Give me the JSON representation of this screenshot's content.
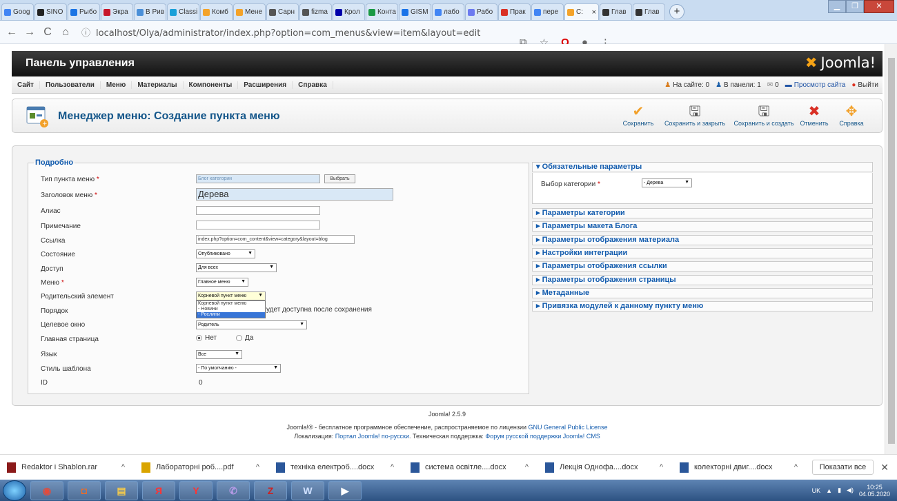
{
  "browser": {
    "tabs": [
      {
        "label": "Goog",
        "color": "#4285f4"
      },
      {
        "label": "SINO",
        "color": "#222"
      },
      {
        "label": "Рыбо",
        "color": "#1b74e4"
      },
      {
        "label": "Экра",
        "color": "#c7172b"
      },
      {
        "label": "В Рив",
        "color": "#4a8fd8"
      },
      {
        "label": "Classi",
        "color": "#1aa0d8"
      },
      {
        "label": "Комб",
        "color": "#f4a32a"
      },
      {
        "label": "Мене",
        "color": "#f4a32a"
      },
      {
        "label": "Сарн",
        "color": "#555"
      },
      {
        "label": "fizma",
        "color": "#555"
      },
      {
        "label": "Крол",
        "color": "#00a"
      },
      {
        "label": "Конта",
        "color": "#1a9944"
      },
      {
        "label": "GISM",
        "color": "#1a73e8"
      },
      {
        "label": "лабо",
        "color": "#4285f4"
      },
      {
        "label": "Рабо",
        "color": "#6b7af0"
      },
      {
        "label": "Прак",
        "color": "#d93025"
      },
      {
        "label": "пере",
        "color": "#4285f4"
      },
      {
        "label": "C:",
        "color": "#f4a32a",
        "active": true
      },
      {
        "label": "Глав",
        "color": "#333"
      },
      {
        "label": "Глав",
        "color": "#333"
      }
    ],
    "url": "localhost/Olya/administrator/index.php?option=com_menus&view=item&layout=edit"
  },
  "header": {
    "title": "Панель управления",
    "logo": "Joomla!"
  },
  "menu": [
    "Сайт",
    "Пользователи",
    "Меню",
    "Материалы",
    "Компоненты",
    "Расширения",
    "Справка"
  ],
  "status": {
    "online": "На сайте: 0",
    "panel": "В панели: 1",
    "messages": "0",
    "view_site": "Просмотр сайта",
    "logout": "Выйти"
  },
  "toolbar": {
    "title": "Менеджер меню: Создание пункта меню",
    "save": "Сохранить",
    "save_close": "Сохранить и закрыть",
    "save_new": "Сохранить и создать",
    "cancel": "Отменить",
    "help": "Справка"
  },
  "form": {
    "legend": "Подробно",
    "type_label": "Тип пункта меню",
    "type_value": "Блог категории",
    "select_btn": "Выбрать",
    "title_label": "Заголовок меню",
    "title_value": "Дерева",
    "alias_label": "Алиас",
    "note_label": "Примечание",
    "link_label": "Ссылка",
    "link_value": "index.php?option=com_content&view=category&layout=blog",
    "state_label": "Состояние",
    "state_value": "Опубликовано",
    "access_label": "Доступ",
    "access_value": "Для всех",
    "menu_label": "Меню",
    "menu_value": "Главное меню",
    "parent_label": "Родительский элемент",
    "parent_value": "Корневой пункт меню",
    "parent_options": [
      "Корневой пункт меню",
      "- Новини",
      "- Рослини"
    ],
    "order_label": "Порядок",
    "order_note": "удет доступна после сохранения",
    "target_label": "Целевое окно",
    "target_value": "Родитель",
    "home_label": "Главная страница",
    "home_no": "Нет",
    "home_yes": "Да",
    "lang_label": "Язык",
    "lang_value": "Все",
    "style_label": "Стиль шаблона",
    "style_value": "- По умолчанию -",
    "id_label": "ID",
    "id_value": "0"
  },
  "panels": {
    "required": "▾ Обязательные параметры",
    "cat_label": "Выбор категории",
    "cat_value": "- Дерева",
    "list": [
      "▸ Параметры категории",
      "▸ Параметры макета Блога",
      "▸ Параметры отображения материала",
      "▸ Настройки интеграции",
      "▸ Параметры отображения ссылки",
      "▸ Параметры отображения страницы",
      "▸ Метаданные",
      "▸ Привязка модулей к данному пункту меню"
    ]
  },
  "footer": {
    "version": "Joomla! 2.5.9",
    "line1a": "Joomla!® - бесплатное программное обеспечение, распространяемое по лицензии ",
    "line1b": "GNU General Public License",
    "line2a": "Локализация: ",
    "line2b": "Портал Joomla! по-русски",
    "line2c": ". Техническая поддержка: ",
    "line2d": "Форум русской поддержки Joomla! CMS"
  },
  "downloads": {
    "items": [
      {
        "name": "Redaktor i Shablon.rar",
        "type": "rar"
      },
      {
        "name": "Лабораторні роб....pdf",
        "type": "pdf"
      },
      {
        "name": "техніка електроб....docx",
        "type": "docx"
      },
      {
        "name": "система освітле....docx",
        "type": "docx"
      },
      {
        "name": "Лекція Однофа....docx",
        "type": "docx"
      },
      {
        "name": "колекторні двиг....docx",
        "type": "docx"
      }
    ],
    "show_all": "Показати все"
  },
  "taskbar": {
    "lang": "UK",
    "time": "10:25",
    "date": "04.05.2020"
  }
}
